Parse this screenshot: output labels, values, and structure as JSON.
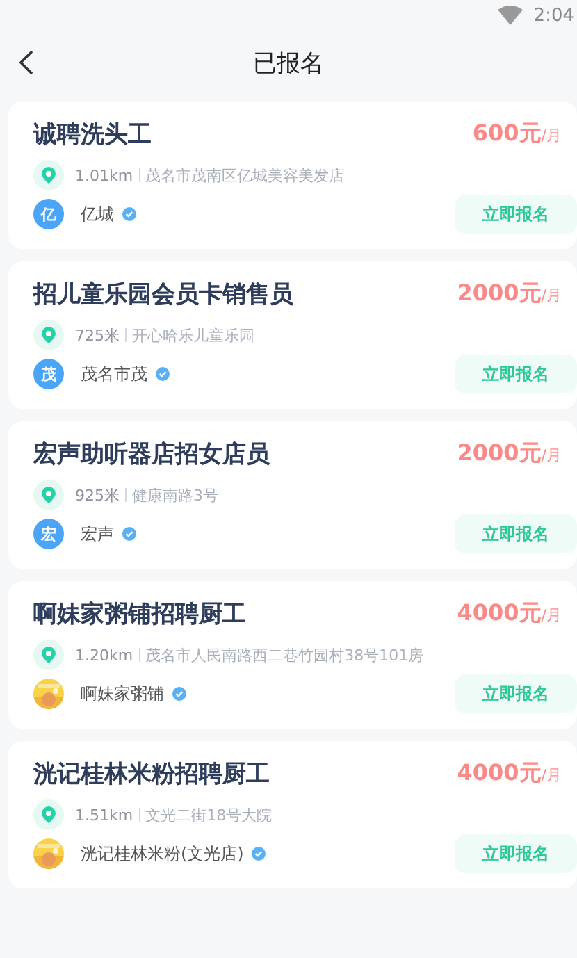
{
  "status_bar": {
    "time": "2:04"
  },
  "header": {
    "title": "已报名"
  },
  "jobs": [
    {
      "title": "诚聘洗头工",
      "salary": "600元",
      "unit": "/月",
      "distance": "1.01km",
      "address": "茂名市茂南区亿城美容美发店",
      "company": "亿城",
      "avatar": {
        "kind": "letter",
        "text": "亿"
      },
      "verified": true,
      "button": "立即报名"
    },
    {
      "title": "招儿童乐园会员卡销售员",
      "salary": "2000元",
      "unit": "/月",
      "distance": "725米",
      "address": "开心哈乐儿童乐园",
      "company": "茂名市茂",
      "avatar": {
        "kind": "letter",
        "text": "茂"
      },
      "verified": true,
      "button": "立即报名"
    },
    {
      "title": "宏声助听器店招女店员",
      "salary": "2000元",
      "unit": "/月",
      "distance": "925米",
      "address": "健康南路3号",
      "company": "宏声",
      "avatar": {
        "kind": "letter",
        "text": "宏"
      },
      "verified": true,
      "button": "立即报名"
    },
    {
      "title": "啊妹家粥铺招聘厨工",
      "salary": "4000元",
      "unit": "/月",
      "distance": "1.20km",
      "address": "茂名市人民南路西二巷竹园村38号101房",
      "company": "啊妹家粥铺",
      "verified": true,
      "button": "立即报名"
    },
    {
      "title": "洸记桂林米粉招聘厨工",
      "salary": "4000元",
      "unit": "/月",
      "distance": "1.51km",
      "address": "文光二街18号大院",
      "company": "洸记桂林米粉(文光店)",
      "verified": true,
      "button": "立即报名"
    }
  ]
}
